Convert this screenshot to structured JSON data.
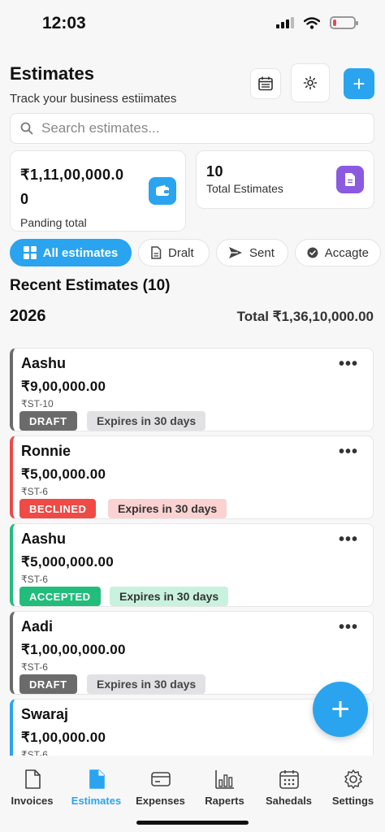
{
  "status_bar": {
    "time": "12:03"
  },
  "header": {
    "title": "Estimates",
    "subtitle": "Track your business estiimates",
    "calendar_icon": "calendar-icon",
    "settings_icon": "gear-icon",
    "add_label": "+"
  },
  "search": {
    "placeholder": "Search estimates...",
    "value": ""
  },
  "stats": {
    "pending_value_line1": "₹1,11,00,000.0",
    "pending_value_line2": "0",
    "pending_label": "Panding total",
    "total_value": "10",
    "total_label": "Total Estimates"
  },
  "filters": [
    {
      "label": "All estimates",
      "icon": "grid-icon",
      "active": true
    },
    {
      "label": "Dralt",
      "icon": "document-icon",
      "active": false
    },
    {
      "label": "Sent",
      "icon": "send-icon",
      "active": false
    },
    {
      "label": "Accagte",
      "icon": "check-circle-icon",
      "active": false
    }
  ],
  "section": {
    "title": "Recent Estimates (10)",
    "year": "2026",
    "year_total": "Total ₹1,36,10,000.00"
  },
  "estimates": [
    {
      "name": "Aashu",
      "amount": "₹9,00,000.00",
      "number": "₹ST-10",
      "status": "DRAFT",
      "expires": "Expires in 30 days"
    },
    {
      "name": "Ronnie",
      "amount": "₹5,00,000.00",
      "number": "₹ST-6",
      "status": "BECLINED",
      "expires": "Expires in 30 days"
    },
    {
      "name": "Aashu",
      "amount": "₹5,000,000.00",
      "number": "₹ST-6",
      "status": "ACCEPTED",
      "expires": "Expires in 30 days"
    },
    {
      "name": "Aadi",
      "amount": "₹1,00,00,000.00",
      "number": "₹ST-6",
      "status": "DRAFT",
      "expires": "Expires in 30 days"
    },
    {
      "name": "Swaraj",
      "amount": "₹1,00,000.00",
      "number": "₹ST-6"
    }
  ],
  "more_label": "•••",
  "fab_label": "+",
  "tabs": [
    {
      "label": "Invoices",
      "icon": "invoice-icon",
      "active": false
    },
    {
      "label": "Estimates",
      "icon": "estimate-icon",
      "active": true
    },
    {
      "label": "Expenses",
      "icon": "card-icon",
      "active": false
    },
    {
      "label": "Raperts",
      "icon": "bar-chart-icon",
      "active": false
    },
    {
      "label": "Sahedals",
      "icon": "calendar-icon",
      "active": false
    },
    {
      "label": "Settings",
      "icon": "gear-icon",
      "active": false
    }
  ],
  "colors": {
    "accent": "#2aa4ef",
    "draft": "#6b6b6b",
    "declined": "#ef4a45",
    "accepted": "#22bd7b",
    "total_icon": "#8a5be0"
  }
}
